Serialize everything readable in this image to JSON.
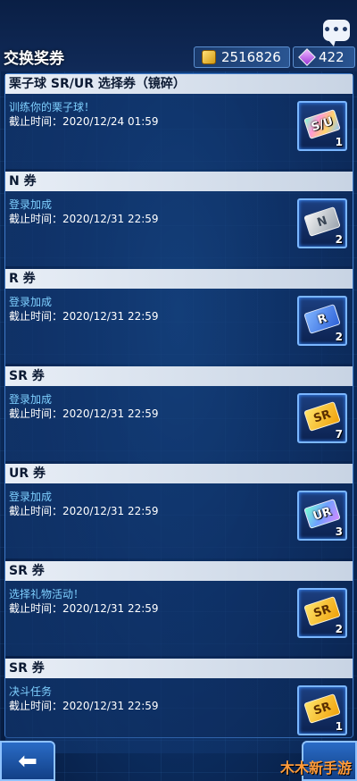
{
  "header": {
    "title": "交换奖券",
    "chat_icon_glyph": "•••",
    "dp": "2516826",
    "gems": "422"
  },
  "sections": [
    {
      "header": "栗子球 SR/UR 选择券（镜碎）",
      "name": "训练你的栗子球！",
      "deadline": "截止时间：2020/12/24 01:59",
      "ticket_label": "S/U",
      "ticket_type": "sr-ur-ticket",
      "count": "1"
    },
    {
      "header": "N 券",
      "name": "登录加成",
      "deadline": "截止时间：2020/12/31 22:59",
      "ticket_label": "N",
      "ticket_type": "n-ticket",
      "count": "2"
    },
    {
      "header": "R 券",
      "name": "登录加成",
      "deadline": "截止时间：2020/12/31 22:59",
      "ticket_label": "R",
      "ticket_type": "r-ticket",
      "count": "2"
    },
    {
      "header": "SR 券",
      "name": "登录加成",
      "deadline": "截止时间：2020/12/31 22:59",
      "ticket_label": "SR",
      "ticket_type": "sr-ticket",
      "count": "7"
    },
    {
      "header": "UR 券",
      "name": "登录加成",
      "deadline": "截止时间：2020/12/31 22:59",
      "ticket_label": "UR",
      "ticket_type": "ur-ticket",
      "count": "3"
    },
    {
      "header": "SR 券",
      "name": "选择礼物活动！",
      "deadline": "截止时间：2020/12/31 22:59",
      "ticket_label": "SR",
      "ticket_type": "sr-ticket",
      "count": "2"
    },
    {
      "header": "SR 券",
      "name": "决斗任务",
      "deadline": "截止时间：2020/12/31 22:59",
      "ticket_label": "SR",
      "ticket_type": "sr-ticket",
      "count": "1"
    }
  ],
  "footer": {
    "back_glyph": "⬅",
    "watermark": "木木新手游"
  },
  "colors": {
    "accent": "#7ab6ff",
    "event_name": "#7fd0ff"
  }
}
